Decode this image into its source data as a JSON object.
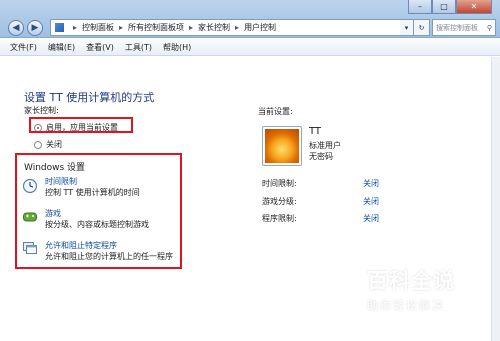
{
  "titlebar": {
    "breadcrumb": [
      "控制面板",
      "所有控制面板项",
      "家长控制",
      "用户控制"
    ],
    "search_placeholder": "搜索控制面板"
  },
  "menubar": {
    "items": [
      "文件(F)",
      "编辑(E)",
      "查看(V)",
      "工具(T)",
      "帮助(H)"
    ]
  },
  "main": {
    "title": "设置 TT 使用计算机的方式",
    "parental_label": "家长控制:",
    "options": [
      {
        "label": "启用，应用当前设置",
        "selected": true
      },
      {
        "label": "关闭",
        "selected": false
      }
    ],
    "windows_settings": {
      "heading": "Windows 设置",
      "items": [
        {
          "title": "时间限制",
          "desc": "控制 TT 使用计算机的时间",
          "icon": "clock-icon"
        },
        {
          "title": "游戏",
          "desc": "按分级、内容或标题控制游戏",
          "icon": "game-icon"
        },
        {
          "title": "允许和阻止特定程序",
          "desc": "允许和阻止您的计算机上的任一程序",
          "icon": "program-icon"
        }
      ]
    }
  },
  "current_settings": {
    "heading": "当前设置:",
    "user_name": "TT",
    "user_type": "标准用户",
    "password": "无密码",
    "rows": [
      {
        "label": "时间限制:",
        "value": "关闭"
      },
      {
        "label": "游戏分级:",
        "value": "关闭"
      },
      {
        "label": "程序限制:",
        "value": "关闭"
      }
    ]
  },
  "watermark": {
    "title": "百科全说",
    "subtitle": "助你轻松解决"
  },
  "colors": {
    "highlight_box": "#e0141e",
    "link": "#0b4ea2",
    "title": "#1e3a8a"
  }
}
